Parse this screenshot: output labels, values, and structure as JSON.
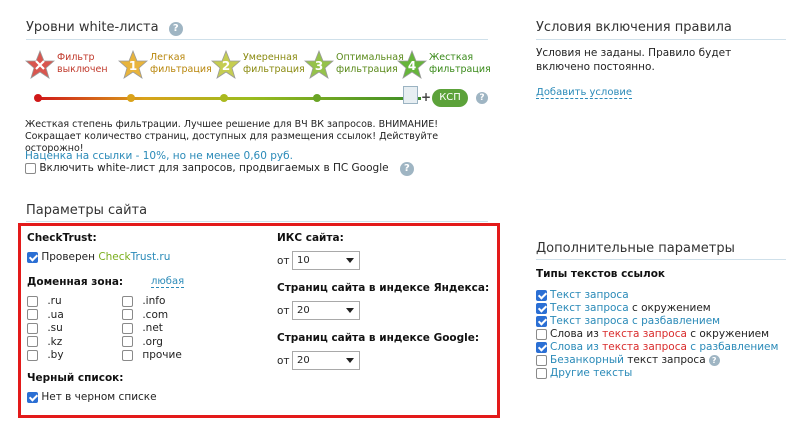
{
  "whitelist": {
    "title": "Уровни white-листа",
    "help": "?",
    "levels": [
      {
        "num": "",
        "line1": "Фильтр",
        "line2": "выключен",
        "color": "#d9564f",
        "text_color": "#c0392b"
      },
      {
        "num": "1",
        "line1": "Легкая",
        "line2": "фильтрация",
        "color": "#e8b43c",
        "text_color": "#b8860b"
      },
      {
        "num": "2",
        "line1": "Умеренная",
        "line2": "фильтрация",
        "color": "#c5cd52",
        "text_color": "#8a8a10"
      },
      {
        "num": "3",
        "line1": "Оптимальная",
        "line2": "фильтрация",
        "color": "#95c24b",
        "text_color": "#5a8a1a"
      },
      {
        "num": "4",
        "line1": "Жесткая",
        "line2": "фильтрация",
        "color": "#66b53b",
        "text_color": "#3a8a1a"
      }
    ],
    "ksp_label": "КСП",
    "plus": "+",
    "description": "Жесткая степень фильтрации. Лучшее решение для ВЧ ВК запросов. ВНИМАНИЕ! Сокращает количество страниц, доступных для размещения ссылок! Действуйте осторожно!",
    "markup_note": "Наценка на ссылки - 10%, но не менее 0,60 руб.",
    "google_checkbox_label": "Включить white-лист для запросов, продвигаемых в ПС Google",
    "google_checked": false
  },
  "conditions": {
    "title": "Условия включения правила",
    "text": "Условия не заданы. Правило будет включено постоянно.",
    "add_link": "Добавить условие"
  },
  "site_params": {
    "title": "Параметры сайта",
    "checktrust_label": "CheckTrust:",
    "checktrust_checked": true,
    "checktrust_prefix": "Проверен ",
    "checktrust_brand_a": "Check",
    "checktrust_brand_b": "Trust.ru",
    "domain_label": "Доменная зона:",
    "domain_any": "любая",
    "domains_col1": [
      ".ru",
      ".ua",
      ".su",
      ".kz",
      ".by"
    ],
    "domains_col2": [
      ".info",
      ".com",
      ".net",
      ".org",
      "прочие"
    ],
    "blacklist_label": "Черный список:",
    "blacklist_option": "Нет в черном списке",
    "blacklist_checked": true,
    "iks_label": "ИКС сайта:",
    "iks_prefix": "от",
    "iks_value": "10",
    "yandex_label": "Страниц сайта в индексе Яндекса:",
    "yandex_prefix": "от",
    "yandex_value": "20",
    "google_label": "Страниц сайта в индексе Google:",
    "google_prefix": "от",
    "google_value": "20"
  },
  "extra": {
    "title": "Дополнительные параметры",
    "subtitle": "Типы текстов ссылок",
    "options": [
      {
        "checked": true,
        "parts": [
          {
            "t": "Текст запроса",
            "c": "link"
          }
        ]
      },
      {
        "checked": true,
        "parts": [
          {
            "t": "Текст запроса",
            "c": "link"
          },
          {
            "t": " с окружением",
            "c": ""
          }
        ]
      },
      {
        "checked": true,
        "parts": [
          {
            "t": "Текст запроса с разбавлением",
            "c": "link"
          }
        ]
      },
      {
        "checked": false,
        "parts": [
          {
            "t": "Слова из ",
            "c": ""
          },
          {
            "t": "текста запроса",
            "c": "red"
          },
          {
            "t": " с окружением",
            "c": ""
          }
        ]
      },
      {
        "checked": true,
        "parts": [
          {
            "t": "Слова из ",
            "c": "link"
          },
          {
            "t": "текста запроса",
            "c": "red"
          },
          {
            "t": " с разбавлением",
            "c": "link"
          }
        ]
      },
      {
        "checked": false,
        "parts": [
          {
            "t": "Безанкорный",
            "c": "link"
          },
          {
            "t": " текст запроса",
            "c": ""
          }
        ],
        "help": true
      },
      {
        "checked": false,
        "parts": [
          {
            "t": "Другие тексты",
            "c": "link"
          }
        ]
      }
    ]
  }
}
